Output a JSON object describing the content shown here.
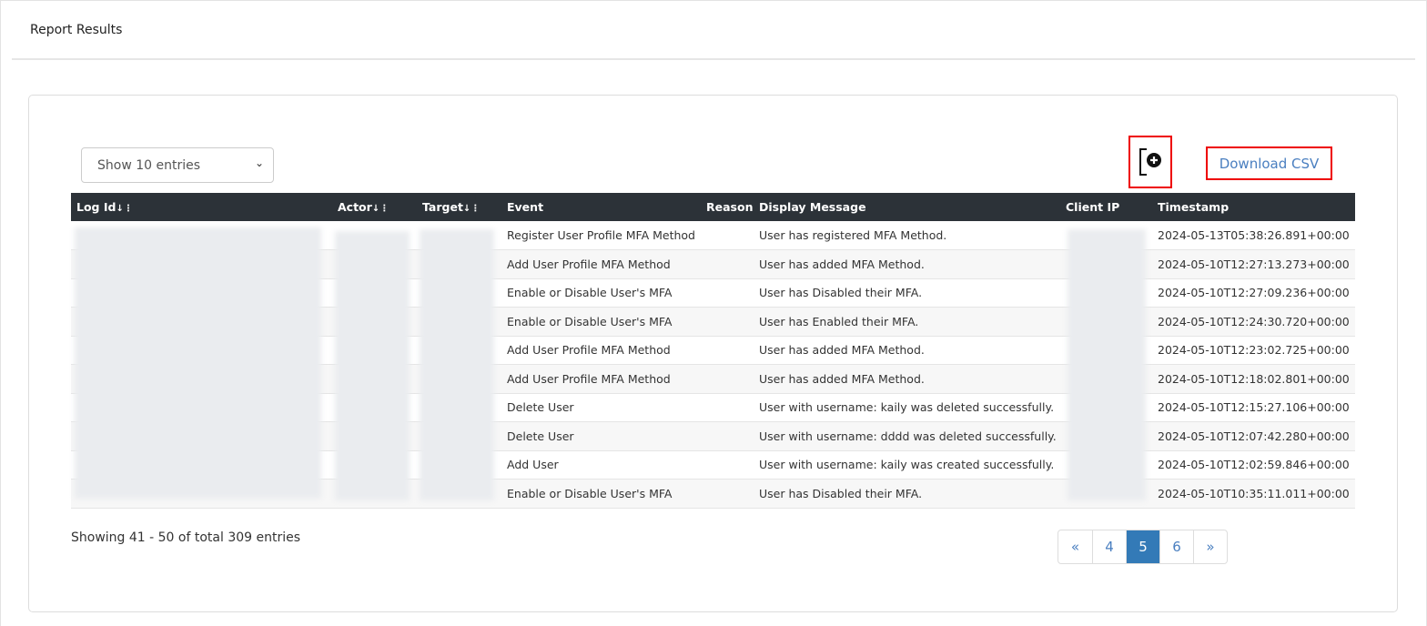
{
  "title": "Report Results",
  "entries_select": {
    "value": "Show 10 entries"
  },
  "toolbar": {
    "add_icon": "file-plus-icon",
    "download_csv": "Download CSV"
  },
  "table": {
    "headers": [
      "Log Id",
      "Actor",
      "Target",
      "Event",
      "Reason",
      "Display Message",
      "Client IP",
      "Timestamp"
    ],
    "rows": [
      {
        "event": "Register User Profile MFA Method",
        "message": "User has registered MFA Method.",
        "timestamp": "2024-05-13T05:38:26.891+00:00"
      },
      {
        "event": "Add User Profile MFA Method",
        "message": "User has added MFA Method.",
        "timestamp": "2024-05-10T12:27:13.273+00:00"
      },
      {
        "event": "Enable or Disable User's MFA",
        "message": "User has Disabled their MFA.",
        "timestamp": "2024-05-10T12:27:09.236+00:00"
      },
      {
        "event": "Enable or Disable User's MFA",
        "message": "User has Enabled their MFA.",
        "timestamp": "2024-05-10T12:24:30.720+00:00"
      },
      {
        "event": "Add User Profile MFA Method",
        "message": "User has added MFA Method.",
        "timestamp": "2024-05-10T12:23:02.725+00:00"
      },
      {
        "event": "Add User Profile MFA Method",
        "message": "User has added MFA Method.",
        "timestamp": "2024-05-10T12:18:02.801+00:00"
      },
      {
        "event": "Delete User",
        "message": "User with username: kaily was deleted successfully.",
        "timestamp": "2024-05-10T12:15:27.106+00:00"
      },
      {
        "event": "Delete User",
        "message": "User with username: dddd was deleted successfully.",
        "timestamp": "2024-05-10T12:07:42.280+00:00"
      },
      {
        "event": "Add User",
        "message": "User with username: kaily was created successfully.",
        "timestamp": "2024-05-10T12:02:59.846+00:00"
      },
      {
        "event": "Enable or Disable User's MFA",
        "message": "User has Disabled their MFA.",
        "timestamp": "2024-05-10T10:35:11.011+00:00"
      }
    ]
  },
  "footer": {
    "info": "Showing 41 - 50 of total 309 entries"
  },
  "pagination": {
    "prev": "«",
    "pages": [
      "4",
      "5",
      "6"
    ],
    "current": "5",
    "next": "»"
  }
}
